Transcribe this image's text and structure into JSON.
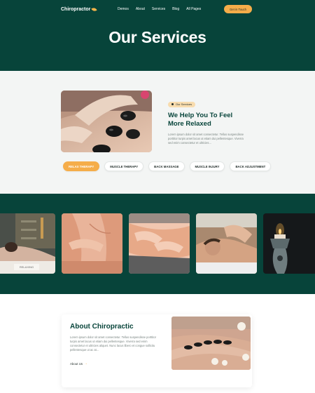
{
  "header": {
    "logo_text": "Chiropractor",
    "nav": [
      "Demos",
      "About",
      "Services",
      "Blog",
      "All Pages"
    ],
    "cta_label": "Get in Touch"
  },
  "hero": {
    "title": "Our Services"
  },
  "services": {
    "badge": "Our Services",
    "heading": "We Help You To Feel More Relaxed",
    "body": "Lorem ipsum dolor sit amet consectetur. Tellus suspendisse porttitor turpis amet lacus ut etiam dui pellentesque. Viverra sed enim consectetur et ultricies...",
    "tabs": [
      "RELAX THERAPY",
      "MUSCLE THERAPY",
      "BACK MASSAGE",
      "MUSCLE INJURY",
      "BACK ADJUSTMENT"
    ],
    "active_tab": "RELAX THERAPY"
  },
  "gallery": {
    "images": [
      "spa-relaxation-photo",
      "back-therapy-photo",
      "back-massage-photo",
      "shoulder-massage-photo",
      "candle-spa-photo"
    ],
    "spa_sign_text": "RELAXING"
  },
  "about": {
    "title": "About Chiropractic",
    "body": "Lorem ipsum dolor sit amet consectetur. Tellus suspendisse porttitor turpis amet lacus ut etiam dui pellentesque. Viverra sed enim consectetur et ultricies aliquet. Nunc lacus libero et congue sollicitu pellentesque ut ac at...",
    "link_label": "About Us"
  },
  "colors": {
    "brand_green": "#07443a",
    "accent_orange": "#f5ad4a",
    "light_bg": "#f3f5f4"
  }
}
